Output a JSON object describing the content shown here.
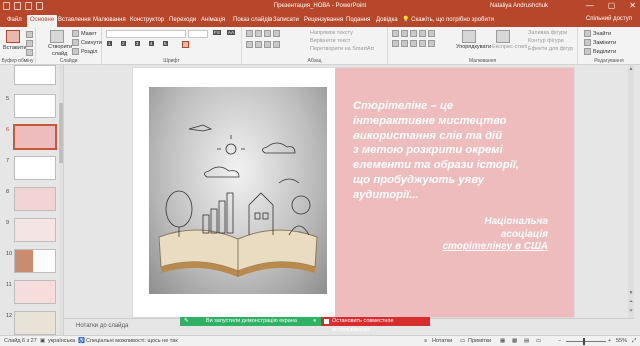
{
  "titlebar": {
    "doc_title": "Презентация_НОВА  -  PowerPoint",
    "user": "Nataliya Andrushchuk",
    "min": "—",
    "max": "▢",
    "close": "✕"
  },
  "tabs": [
    {
      "label": "Файл"
    },
    {
      "label": "Основне"
    },
    {
      "label": "Вставлення"
    },
    {
      "label": "Малювання"
    },
    {
      "label": "Конструктор"
    },
    {
      "label": "Переходи"
    },
    {
      "label": "Анімація"
    },
    {
      "label": "Показ слайдів"
    },
    {
      "label": "Записати"
    },
    {
      "label": "Рецензування"
    },
    {
      "label": "Подання"
    },
    {
      "label": "Довідка"
    }
  ],
  "tell_me": "Скажіть, що потрібно зробити",
  "share": "Спільний доступ",
  "ribbon": {
    "clipboard": {
      "paste": "Вставити",
      "group": "Буфер обміну"
    },
    "slides": {
      "new": "Створити",
      "new2": "слайд",
      "layout": "Макет",
      "reset": "Скинути",
      "section": "Розділ",
      "group": "Слайди"
    },
    "font": {
      "group": "Шрифт",
      "keytip_size": "FS",
      "keytip_a": "AA",
      "keytip_b": "1",
      "keytip_i": "2",
      "keytip_u": "3",
      "keytip_s": "4",
      "keytip_c": "5"
    },
    "paragraph": {
      "text_dir": "Напрямок тексту",
      "align_text": "Вирівняти текст",
      "smartart": "Перетворити на SmartArt",
      "group": "Абзац"
    },
    "drawing": {
      "arrange": "Упорядкувати",
      "quick_styles": "Експрес-стилі",
      "fill": "Заливка фігури",
      "outline": "Контур фігури",
      "effects": "Ефекти для фігур",
      "group": "Малювання"
    },
    "editing": {
      "find": "Знайти",
      "replace": "Замінити",
      "select": "Виділити",
      "group": "Редагування"
    }
  },
  "thumbnails": [
    {
      "num": "5"
    },
    {
      "num": "6",
      "selected": true
    },
    {
      "num": "7"
    },
    {
      "num": "8"
    },
    {
      "num": "9"
    },
    {
      "num": "10"
    },
    {
      "num": "11"
    },
    {
      "num": "12"
    }
  ],
  "slide": {
    "quote_lines": [
      "Сторітелінг – це",
      "інтерактивне мистецтво",
      "використання слів та дій",
      "з метою розкрити окремі",
      "елементи та образи історії,",
      "що пробуджують уяву",
      "аудиторії..."
    ],
    "source_line1": "Національна",
    "source_line2": "асоціація",
    "source_line3": "сторітелінгу в США"
  },
  "notes_placeholder": "Нотатки до слайда",
  "sharing": {
    "message": "Ви запустили демонстрацію екрана",
    "stop": "Остановить совместное использование"
  },
  "statusbar": {
    "slide_info": "Слайд 6 з 27",
    "language": "українська",
    "accessibility": "Спеціальні можливості: щось не так",
    "notes": "Нотатки",
    "comments": "Примітки",
    "zoom": "55%"
  },
  "colors": {
    "accent": "#b7472a",
    "panel": "#eebcbd",
    "share_green": "#2fb266",
    "stop_red": "#d62e2e"
  }
}
